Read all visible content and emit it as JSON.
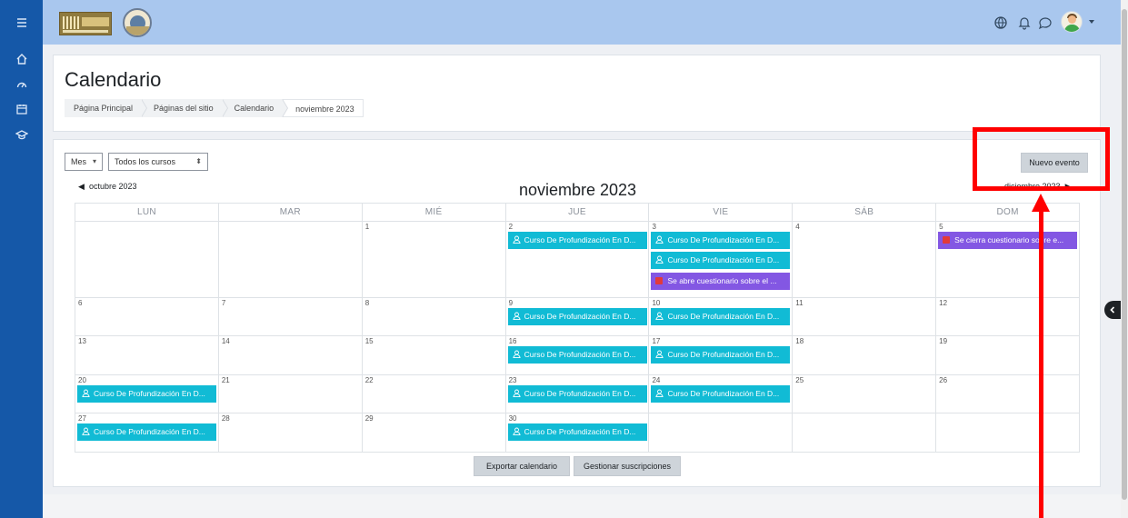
{
  "header": {
    "title": "Calendario",
    "breadcrumb": [
      "Página Principal",
      "Páginas del sitio",
      "Calendario",
      "noviembre 2023"
    ]
  },
  "toolbar": {
    "view_select": "Mes",
    "course_select": "Todos los cursos",
    "new_event": "Nuevo evento"
  },
  "calendar": {
    "month_title": "noviembre 2023",
    "prev_month": "octubre 2023",
    "next_month": "diciembre 2023",
    "day_headers": [
      "LUN",
      "MAR",
      "MIÉ",
      "JUE",
      "VIE",
      "SÁB",
      "DOM"
    ],
    "weeks": [
      {
        "days": [
          "",
          "",
          "1",
          "2",
          "3",
          "4",
          "5"
        ]
      },
      {
        "days": [
          "6",
          "7",
          "8",
          "9",
          "10",
          "11",
          "12"
        ]
      },
      {
        "days": [
          "13",
          "14",
          "15",
          "16",
          "17",
          "18",
          "19"
        ]
      },
      {
        "days": [
          "20",
          "21",
          "22",
          "23",
          "24",
          "25",
          "26"
        ]
      },
      {
        "days": [
          "27",
          "28",
          "29",
          "30",
          "",
          "",
          ""
        ]
      }
    ],
    "event_course": "Curso De Profundización En D...",
    "event_quiz_open": "Se abre cuestionario sobre el ...",
    "event_quiz_close": "Se cierra cuestionario sobre e..."
  },
  "footer_buttons": {
    "export": "Exportar calendario",
    "manage": "Gestionar suscripciones"
  },
  "colors": {
    "course_event": "#11bbd5",
    "quiz_event": "#8357e3",
    "highlight": "#ff0000",
    "sidebar": "#1558a8",
    "topbar": "#a9c7ee"
  }
}
